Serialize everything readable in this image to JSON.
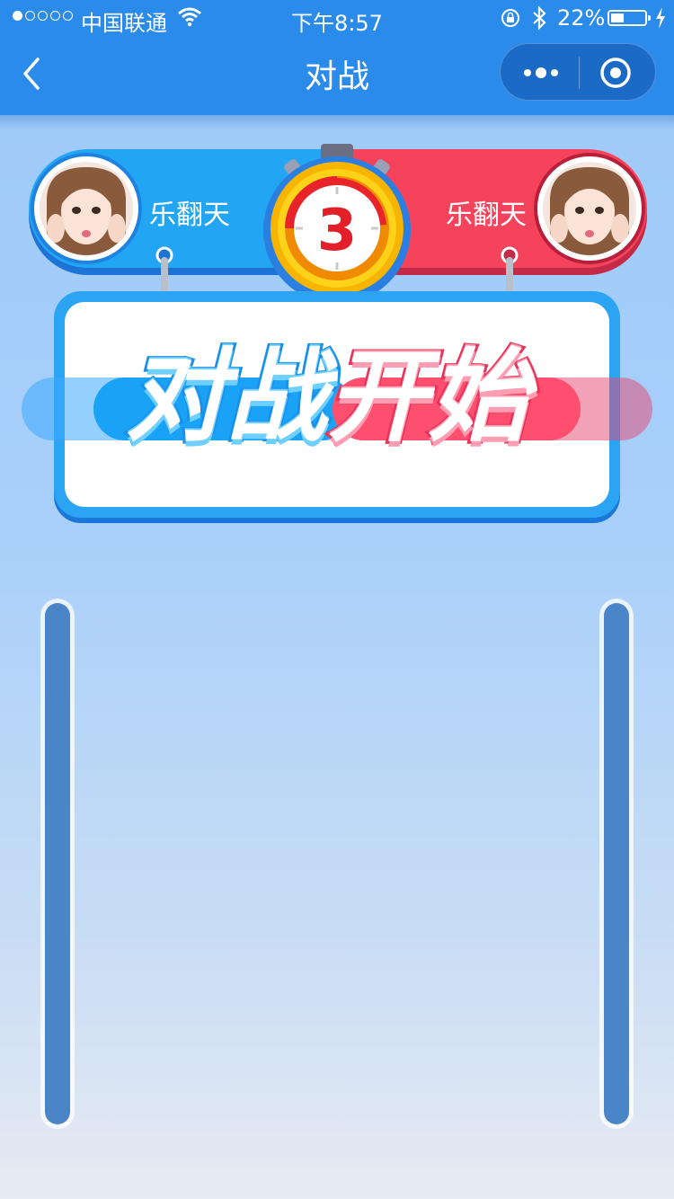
{
  "status_bar": {
    "carrier": "中国联通",
    "time": "下午8:57",
    "battery": "22%"
  },
  "nav": {
    "title": "对战",
    "icons": [
      "back-chevron-icon",
      "more-dots-icon",
      "close-target-icon"
    ]
  },
  "players": {
    "left": {
      "name": "乐翻天",
      "color": "#22a6f4"
    },
    "right": {
      "name": "乐翻天",
      "color": "#f5435c"
    }
  },
  "timer": {
    "count": "3"
  },
  "banner": {
    "left_text": "对战",
    "right_text": "开始"
  },
  "score_tracks": {
    "left_fill": 1.0,
    "right_fill": 1.0
  }
}
